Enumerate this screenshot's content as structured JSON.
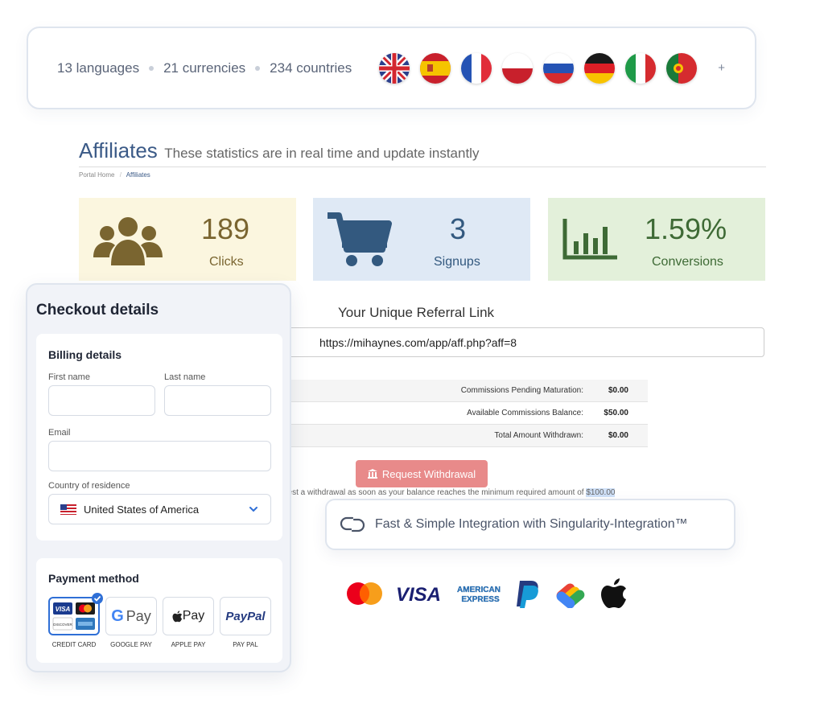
{
  "langbar": {
    "languages": "13 languages",
    "currencies": "21 currencies",
    "countries": "234 countries",
    "flags": [
      "uk-flag-icon",
      "spain-flag-icon",
      "france-flag-icon",
      "poland-flag-icon",
      "russia-flag-icon",
      "germany-flag-icon",
      "italy-flag-icon",
      "portugal-flag-icon"
    ],
    "more": "+"
  },
  "affiliates": {
    "title": "Affiliates",
    "subtitle": "These statistics are in real time and update instantly",
    "breadcrumb": {
      "home": "Portal Home",
      "sep": "/",
      "current": "Affiliates"
    },
    "cards": [
      {
        "value": "189",
        "label": "Clicks",
        "icon": "users-icon",
        "bg": "#fbf6df",
        "color": "#7a6530"
      },
      {
        "value": "3",
        "label": "Signups",
        "icon": "cart-icon",
        "bg": "#dfe9f5",
        "color": "#33597f"
      },
      {
        "value": "1.59%",
        "label": "Conversions",
        "icon": "bar-chart-icon",
        "bg": "#e3f0da",
        "color": "#3e6a35"
      }
    ],
    "referral_label": "Your Unique Referral Link",
    "referral_url": "https://mihaynes.com/app/aff.php?aff=8",
    "commissions": [
      {
        "label": "Commissions Pending Maturation:",
        "value": "$0.00"
      },
      {
        "label": "Available Commissions Balance:",
        "value": "$50.00"
      },
      {
        "label": "Total Amount Withdrawn:",
        "value": "$0.00"
      }
    ],
    "withdraw_button": "Request Withdrawal",
    "withdraw_note": "uest a withdrawal as soon as your balance reaches the minimum required amount of ",
    "withdraw_min": "$100.00"
  },
  "integration": {
    "text": "Fast & Simple Integration with Singularity-Integration™"
  },
  "payment_logos": [
    "mastercard-icon",
    "visa-icon",
    "amex-icon",
    "paypal-icon",
    "google-pay-icon",
    "apple-icon"
  ],
  "logo_text": {
    "visa": "VISA",
    "amex_top": "AMERICAN",
    "amex_bottom": "EXPRESS"
  },
  "checkout": {
    "title": "Checkout details",
    "billing_title": "Billing details",
    "first_name_label": "First name",
    "last_name_label": "Last name",
    "email_label": "Email",
    "country_label": "Country of residence",
    "country_value": "United States of America",
    "payment_title": "Payment method",
    "methods": [
      {
        "label": "CREDIT CARD",
        "selected": true
      },
      {
        "label": "GOOGLE PAY",
        "selected": false
      },
      {
        "label": "APPLE PAY",
        "selected": false
      },
      {
        "label": "PAY PAL",
        "selected": false
      }
    ],
    "gpay_text": "Pay",
    "applepay_text": "Pay",
    "paypal_text": "PayPal",
    "card_visa": "VISA",
    "card_discover": "DISCOVER"
  },
  "colors": {
    "accent": "#2f6fd6",
    "affiliate_title": "#3b5a87",
    "withdraw_button": "#e88a8a"
  }
}
